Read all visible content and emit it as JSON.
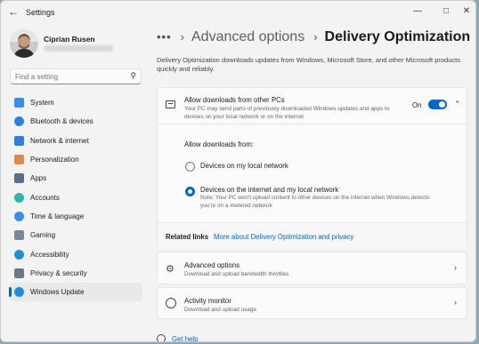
{
  "window": {
    "title": "Settings",
    "back_glyph": "←",
    "controls": {
      "minimize": "—",
      "maximize": "□",
      "close": "✕"
    }
  },
  "user": {
    "name": "Ciprian Rusen"
  },
  "search": {
    "placeholder": "Find a setting"
  },
  "sidebar": {
    "items": [
      {
        "label": "System",
        "icon": "monitor-icon",
        "color": "#3a8ee6"
      },
      {
        "label": "Bluetooth & devices",
        "icon": "bluetooth-icon",
        "color": "#2f7fe0"
      },
      {
        "label": "Network & internet",
        "icon": "wifi-icon",
        "color": "#2f7fe0"
      },
      {
        "label": "Personalization",
        "icon": "brush-icon",
        "color": "#e0894a"
      },
      {
        "label": "Apps",
        "icon": "apps-icon",
        "color": "#5c6d8a"
      },
      {
        "label": "Accounts",
        "icon": "person-icon",
        "color": "#2fb4a6"
      },
      {
        "label": "Time & language",
        "icon": "globe-clock-icon",
        "color": "#3a8ee6"
      },
      {
        "label": "Gaming",
        "icon": "controller-icon",
        "color": "#7b8794"
      },
      {
        "label": "Accessibility",
        "icon": "accessibility-icon",
        "color": "#1f8fdc"
      },
      {
        "label": "Privacy & security",
        "icon": "shield-icon",
        "color": "#6b7785"
      },
      {
        "label": "Windows Update",
        "icon": "update-icon",
        "color": "#1f8fdc",
        "active": true
      }
    ]
  },
  "breadcrumb": {
    "overflow": "•••",
    "sep": "›",
    "parent": "Advanced options",
    "current": "Delivery Optimization"
  },
  "description": "Delivery Optimization downloads updates from Windows, Microsoft Store, and other Microsoft products quickly and reliably.",
  "allow_card": {
    "title": "Allow downloads from other PCs",
    "subtitle": "Your PC may send parts of previously downloaded Windows updates and apps to devices on your local network or on the internet",
    "toggle_label": "On",
    "toggle_on": true
  },
  "allow_from": {
    "label": "Allow downloads from:",
    "options": [
      {
        "label": "Devices on my local network",
        "selected": false
      },
      {
        "label": "Devices on the internet and my local network",
        "selected": true,
        "note": "Note: Your PC won't upload content to other devices on the internet when Windows detects you're on a metered network"
      }
    ]
  },
  "related": {
    "heading": "Related links",
    "link": "More about Delivery Optimization and privacy"
  },
  "advanced_card": {
    "title": "Advanced options",
    "subtitle": "Download and upload bandwidth throttles"
  },
  "activity_card": {
    "title": "Activity monitor",
    "subtitle": "Download and upload usage"
  },
  "help": {
    "label": "Get help"
  },
  "colors": {
    "accent": "#0067c0"
  }
}
